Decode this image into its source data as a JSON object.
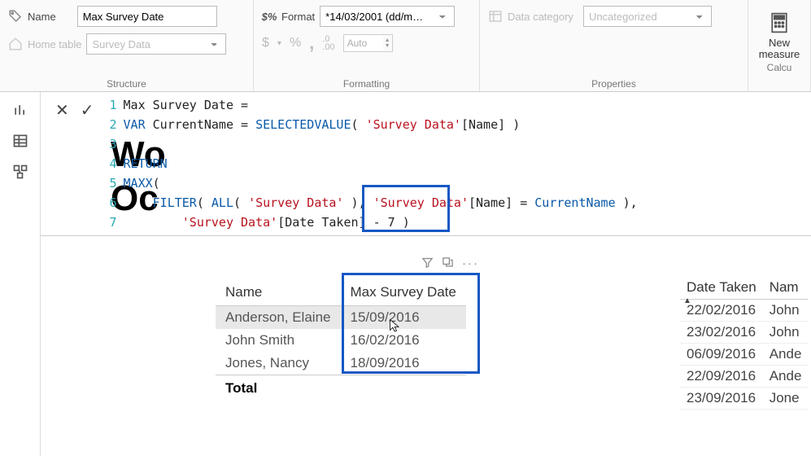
{
  "ribbon": {
    "structure": {
      "name_label": "Name",
      "name_value": "Max Survey Date",
      "home_table_label": "Home table",
      "home_table_value": "Survey Data",
      "group_label": "Structure"
    },
    "formatting": {
      "format_label": "Format",
      "format_value": "*14/03/2001 (dd/m…",
      "currency": "$",
      "percent": "%",
      "comma": ",",
      "decimals_icon": ".00",
      "auto_value": "Auto",
      "group_label": "Formatting"
    },
    "properties": {
      "datacat_label": "Data category",
      "datacat_value": "Uncategorized",
      "group_label": "Properties"
    },
    "calc": {
      "new_measure_label": "New measure",
      "group_label": "Calcu"
    }
  },
  "formula": {
    "line1_a": "Max Survey Date ",
    "line1_b": "=",
    "line2_var": "VAR",
    "line2_name": " CurrentName ",
    "line2_eq": "= ",
    "line2_fn": "SELECTEDVALUE",
    "line2_paren_o": "( ",
    "line2_str": "'Survey Data'",
    "line2_col": "[Name] ",
    "line2_paren_c": ")",
    "line4_ret": "RETURN",
    "line5_fn": "MAXX",
    "line5_paren": "(",
    "line6_ind": "    ",
    "line6_fn1": "FILTER",
    "line6_p1": "( ",
    "line6_fn2": "ALL",
    "line6_p2": "( ",
    "line6_str1": "'Survey Data'",
    "line6_mid1": " ), ",
    "line6_str2": "'Survey Data'",
    "line6_col": "[Name] ",
    "line6_eq": "= ",
    "line6_cn": "CurrentName ",
    "line6_end": "),",
    "line7_ind": "        ",
    "line7_str": "'Survey Data'",
    "line7_col": "[Date Taken] ",
    "line7_minus": "- ",
    "line7_seven": "7 ",
    "line7_paren": ")"
  },
  "wo_text_1": "Wo",
  "wo_text_2": "Oc",
  "table1": {
    "h1": "Name",
    "h2": "Max Survey Date",
    "rows": [
      {
        "name": "Anderson, Elaine",
        "date": "15/09/2016"
      },
      {
        "name": "John Smith",
        "date": "16/02/2016"
      },
      {
        "name": "Jones, Nancy",
        "date": "18/09/2016"
      }
    ],
    "total_label": "Total"
  },
  "table2": {
    "h1": "Date Taken",
    "h2": "Nam",
    "rows": [
      {
        "date": "22/02/2016",
        "name": "John"
      },
      {
        "date": "23/02/2016",
        "name": "John"
      },
      {
        "date": "06/09/2016",
        "name": "Ande"
      },
      {
        "date": "22/09/2016",
        "name": "Ande"
      },
      {
        "date": "23/09/2016",
        "name": "Jone"
      }
    ]
  }
}
